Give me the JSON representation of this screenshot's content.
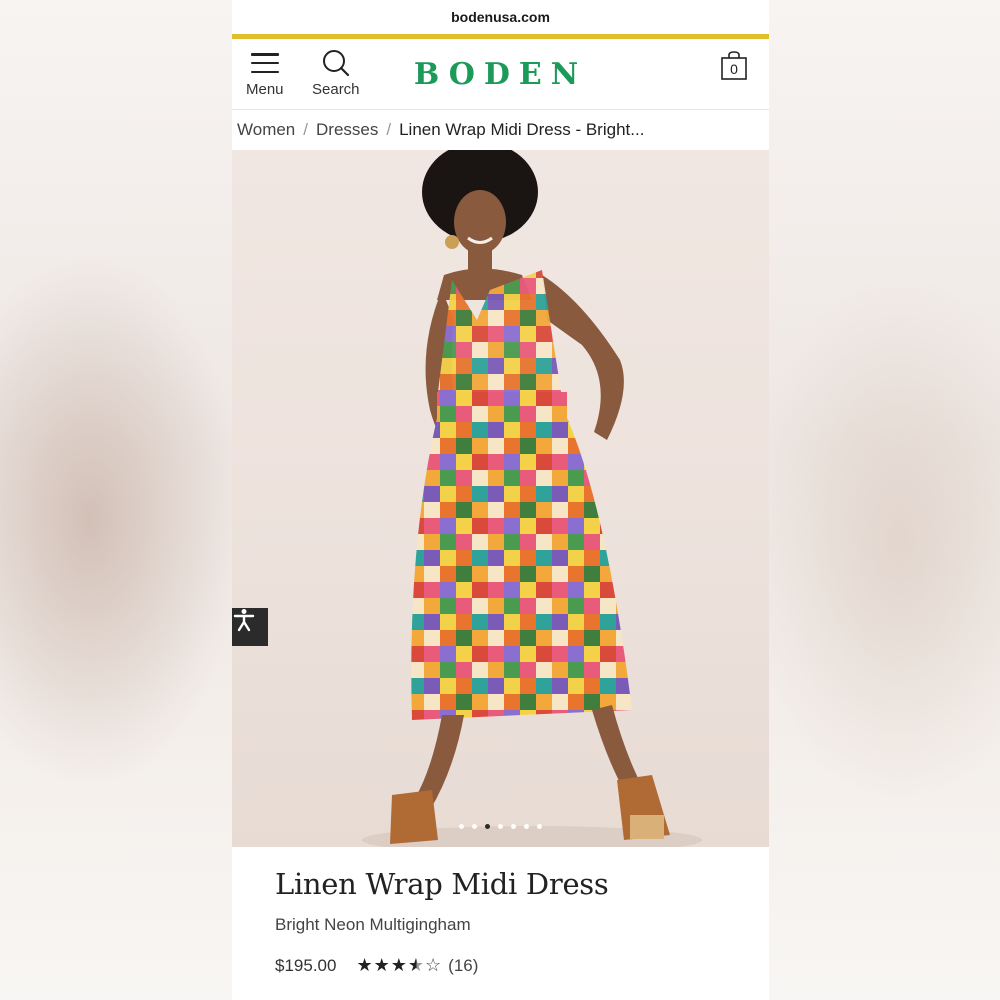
{
  "browser": {
    "url": "bodenusa.com"
  },
  "header": {
    "menu_label": "Menu",
    "search_label": "Search",
    "logo_text": "BODEN",
    "bag_count": "0",
    "accent_color": "#e0c02a",
    "brand_color": "#1b9a5a"
  },
  "breadcrumb": {
    "items": [
      "Women",
      "Dresses"
    ],
    "current": "Linen Wrap Midi Dress - Bright..."
  },
  "gallery": {
    "image_count": 7,
    "active_index": 3
  },
  "product": {
    "title": "Linen Wrap Midi Dress",
    "color_name": "Bright Neon Multigingham",
    "price": "$195.00",
    "rating": 3.5,
    "rating_max": 5,
    "review_count": "(16)"
  },
  "icons": {
    "menu": "hamburger-icon",
    "search": "search-icon",
    "bag": "shopping-bag-icon",
    "accessibility": "accessibility-icon"
  }
}
